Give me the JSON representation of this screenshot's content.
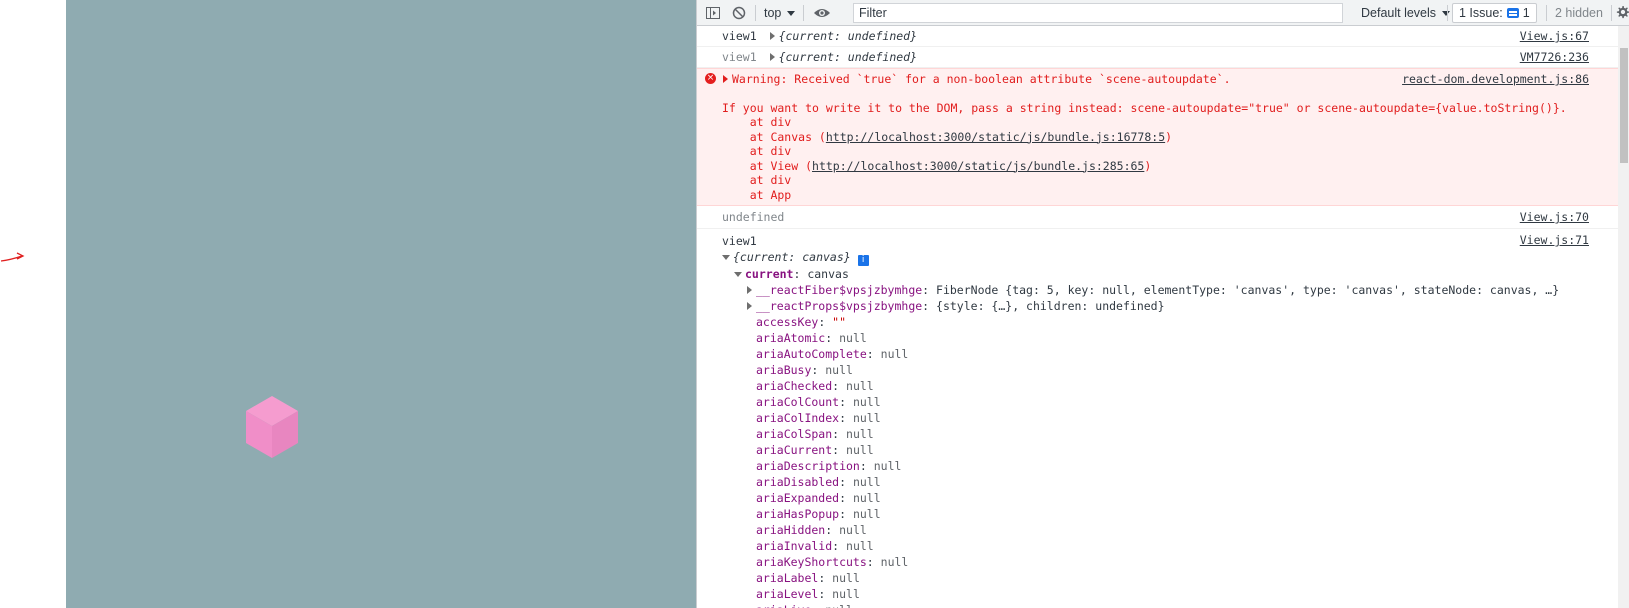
{
  "toolbar": {
    "context": "top",
    "filter_placeholder": "Filter",
    "levels": "Default levels",
    "issues_label": "1 Issue:",
    "issues_count": "1",
    "hidden": "2 hidden"
  },
  "console": {
    "msg1": {
      "label": "view1",
      "value": "{current: undefined}",
      "source": "View.js:67"
    },
    "msg2": {
      "label": "view1",
      "value": "{current: undefined}",
      "source": "VM7726:236"
    },
    "error": {
      "title": "Warning: Received `true` for a non-boolean attribute `scene-autoupdate`.",
      "source": "react-dom.development.js:86",
      "hint": "If you want to write it to the DOM, pass a string instead: scene-autoupdate=\"true\" or scene-autoupdate={value.toString()}.",
      "stack": [
        {
          "text": "    at div",
          "link": ""
        },
        {
          "text": "    at Canvas (",
          "link": "http://localhost:3000/static/js/bundle.js:16778:5",
          "end": ")"
        },
        {
          "text": "    at div",
          "link": ""
        },
        {
          "text": "    at View (",
          "link": "http://localhost:3000/static/js/bundle.js:285:65",
          "end": ")"
        },
        {
          "text": "    at div",
          "link": ""
        },
        {
          "text": "    at App",
          "link": ""
        }
      ]
    },
    "msg3": {
      "value": "undefined",
      "source": "View.js:70"
    },
    "msg4": {
      "label": "view1",
      "source": "View.js:71",
      "object": "{current: canvas}",
      "current_key": "current",
      "current_value": "canvas",
      "fiber_key": "__reactFiber$vpsjzbymhge",
      "fiber_value": "FiberNode {tag: 5, key: null, elementType: 'canvas', type: 'canvas', stateNode: canvas, …}",
      "props_key": "__reactProps$vpsjzbymhge",
      "props_value": "{style: {…}, children: undefined}",
      "properties": [
        {
          "key": "accessKey",
          "value": "\"\""
        },
        {
          "key": "ariaAtomic",
          "value": "null"
        },
        {
          "key": "ariaAutoComplete",
          "value": "null"
        },
        {
          "key": "ariaBusy",
          "value": "null"
        },
        {
          "key": "ariaChecked",
          "value": "null"
        },
        {
          "key": "ariaColCount",
          "value": "null"
        },
        {
          "key": "ariaColIndex",
          "value": "null"
        },
        {
          "key": "ariaColSpan",
          "value": "null"
        },
        {
          "key": "ariaCurrent",
          "value": "null"
        },
        {
          "key": "ariaDescription",
          "value": "null"
        },
        {
          "key": "ariaDisabled",
          "value": "null"
        },
        {
          "key": "ariaExpanded",
          "value": "null"
        },
        {
          "key": "ariaHasPopup",
          "value": "null"
        },
        {
          "key": "ariaHidden",
          "value": "null"
        },
        {
          "key": "ariaInvalid",
          "value": "null"
        },
        {
          "key": "ariaKeyShortcuts",
          "value": "null"
        },
        {
          "key": "ariaLabel",
          "value": "null"
        },
        {
          "key": "ariaLevel",
          "value": "null"
        },
        {
          "key": "ariaLive",
          "value": "null"
        }
      ]
    }
  },
  "colors": {
    "canvas_bg": "#8fabb1",
    "cube": "#f08ec8",
    "error_text": "#e11d1d",
    "error_bg": "#fff0f0"
  },
  "icons": [
    "sidebar-toggle-icon",
    "clear-console-icon",
    "dropdown-arrow-icon",
    "eye-icon",
    "settings-gear-icon",
    "error-icon",
    "info-icon",
    "red-arrow-annotation"
  ]
}
